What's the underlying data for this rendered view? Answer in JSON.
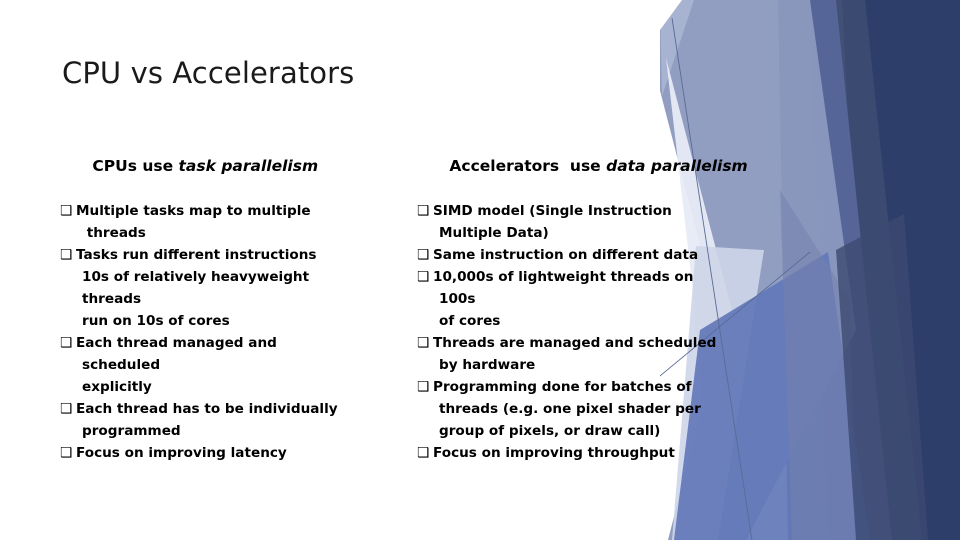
{
  "slide": {
    "title": "CPU vs Accelerators",
    "bullet_glyph": "❑",
    "background": "white",
    "text_color": "#000000",
    "title_color": "#1a1a1a"
  },
  "decor": {
    "name": "angled-blue-polygons",
    "colors": {
      "navy_dark": "#2d3e6b",
      "navy": "#3c4a72",
      "steel": "#58679a",
      "royal": "#6379b8",
      "periwinkle": "#7482ad",
      "light_periwinkle": "#8b99bf",
      "pale": "#aab6d4",
      "paler": "#cdd5e8",
      "palest": "#e7ebf5",
      "hairline": "#5a6b96"
    }
  },
  "columns": [
    {
      "id": "cpu",
      "head_plain": "CPUs use ",
      "head_italic": "task parallelism",
      "lines": [
        {
          "bullet": true,
          "text": "Multiple tasks map to multiple"
        },
        {
          "bullet": false,
          "text": " threads"
        },
        {
          "bullet": true,
          "text": "Tasks run different instructions"
        },
        {
          "bullet": false,
          "text": "10s of relatively heavyweight"
        },
        {
          "bullet": false,
          "text": "threads"
        },
        {
          "bullet": false,
          "text": "run on 10s of cores"
        },
        {
          "bullet": true,
          "text": "Each thread managed and"
        },
        {
          "bullet": false,
          "text": "scheduled"
        },
        {
          "bullet": false,
          "text": "explicitly"
        },
        {
          "bullet": true,
          "text": "Each thread has to be individually"
        },
        {
          "bullet": false,
          "text": "programmed"
        },
        {
          "bullet": true,
          "text": "Focus on improving latency"
        }
      ]
    },
    {
      "id": "accelerators",
      "head_plain": "Accelerators  use ",
      "head_italic": "data parallelism",
      "lines": [
        {
          "bullet": true,
          "text": "SIMD model (Single Instruction"
        },
        {
          "bullet": false,
          "text": "Multiple Data)"
        },
        {
          "bullet": true,
          "text": "Same instruction on different data"
        },
        {
          "bullet": true,
          "text": "10,000s of lightweight threads on"
        },
        {
          "bullet": false,
          "text": "100s"
        },
        {
          "bullet": false,
          "text": "of cores"
        },
        {
          "bullet": true,
          "text": "Threads are managed and scheduled"
        },
        {
          "bullet": false,
          "text": "by hardware"
        },
        {
          "bullet": true,
          "text": "Programming done for batches of"
        },
        {
          "bullet": false,
          "text": "threads (e.g. one pixel shader per"
        },
        {
          "bullet": false,
          "text": "group of pixels, or draw call)"
        },
        {
          "bullet": true,
          "text": "Focus on improving throughput"
        }
      ]
    }
  ]
}
